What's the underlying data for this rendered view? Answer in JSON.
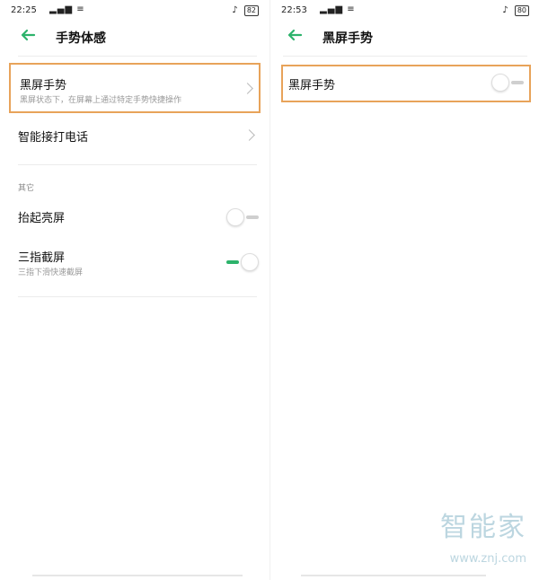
{
  "left": {
    "status": {
      "time": "22:25",
      "signal": "▂▄▆ ≡",
      "right": "♪",
      "battery": "82"
    },
    "title": "手势体感",
    "items": [
      {
        "label": "黑屏手势",
        "sub": "黑屏状态下，在屏幕上通过特定手势快捷操作"
      },
      {
        "label": "智能接打电话"
      }
    ],
    "section_label": "其它",
    "toggles": [
      {
        "label": "抬起亮屏",
        "state": "off"
      },
      {
        "label": "三指截屏",
        "sub": "三指下滑快速截屏",
        "state": "on"
      }
    ]
  },
  "right": {
    "status": {
      "time": "22:53",
      "signal": "▂▄▆ ≡",
      "right": "♪",
      "battery": "80"
    },
    "title": "黑屏手势",
    "toggle": {
      "label": "黑屏手势",
      "state": "off"
    }
  },
  "watermark": {
    "cn": "智能家",
    "en": "www.znj.com"
  },
  "colors": {
    "accent": "#2db36b",
    "highlight": "#e8a35a"
  }
}
